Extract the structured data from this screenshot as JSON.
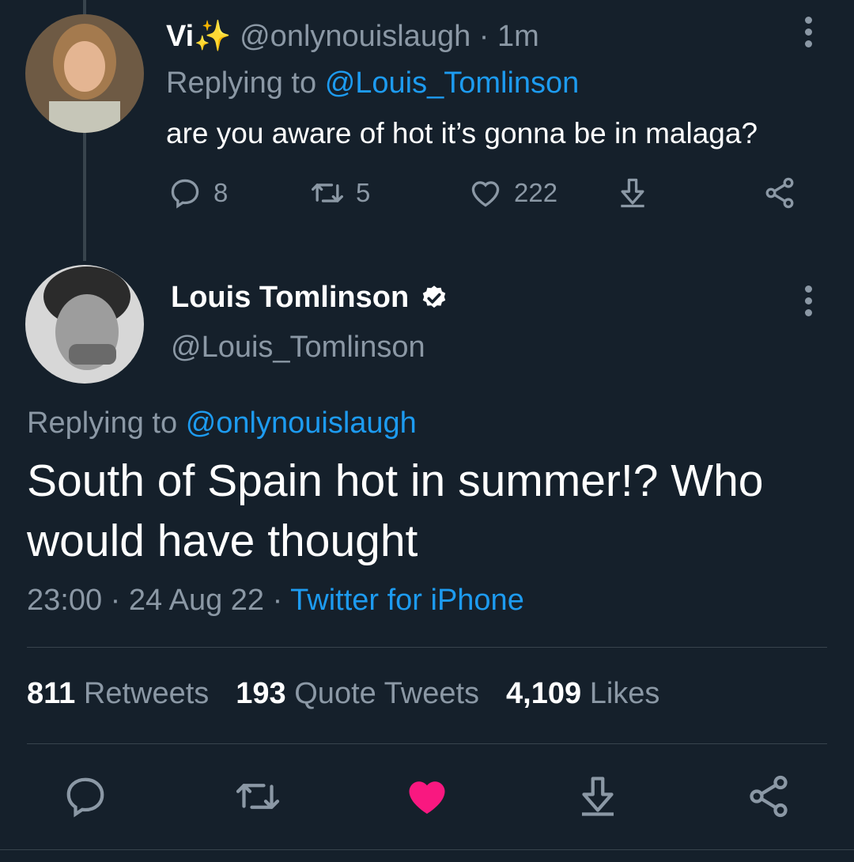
{
  "reply_tweet": {
    "display_name": "Vi",
    "name_emoji": "✨",
    "handle": "@onlynouislaugh",
    "separator": "·",
    "time": "1m",
    "replying_prefix": "Replying to",
    "replying_to": "@Louis_Tomlinson",
    "text": "are you aware of hot it’s gonna be in malaga?",
    "replies": "8",
    "retweets": "5",
    "likes": "222"
  },
  "main_tweet": {
    "display_name": "Louis Tomlinson",
    "verified": true,
    "handle": "@Louis_Tomlinson",
    "replying_prefix": "Replying to",
    "replying_to": "@onlynouislaugh",
    "text": "South of Spain hot in summer!? Who would have thought",
    "time": "23:00",
    "sep1": "·",
    "date": "24 Aug 22",
    "sep2": "·",
    "source": "Twitter for iPhone",
    "stats": {
      "retweets_count": "811",
      "retweets_label": "Retweets",
      "quotes_count": "193",
      "quotes_label": "Quote Tweets",
      "likes_count": "4,109",
      "likes_label": "Likes"
    },
    "liked": true
  },
  "colors": {
    "background": "#15202b",
    "link": "#1d9bf0",
    "muted": "#8b98a5",
    "like_active": "#f91880"
  },
  "icons": [
    "reply-icon",
    "retweet-icon",
    "heart-icon",
    "download-icon",
    "share-icon",
    "more-icon",
    "verified-badge-icon",
    "sparkles-icon"
  ]
}
